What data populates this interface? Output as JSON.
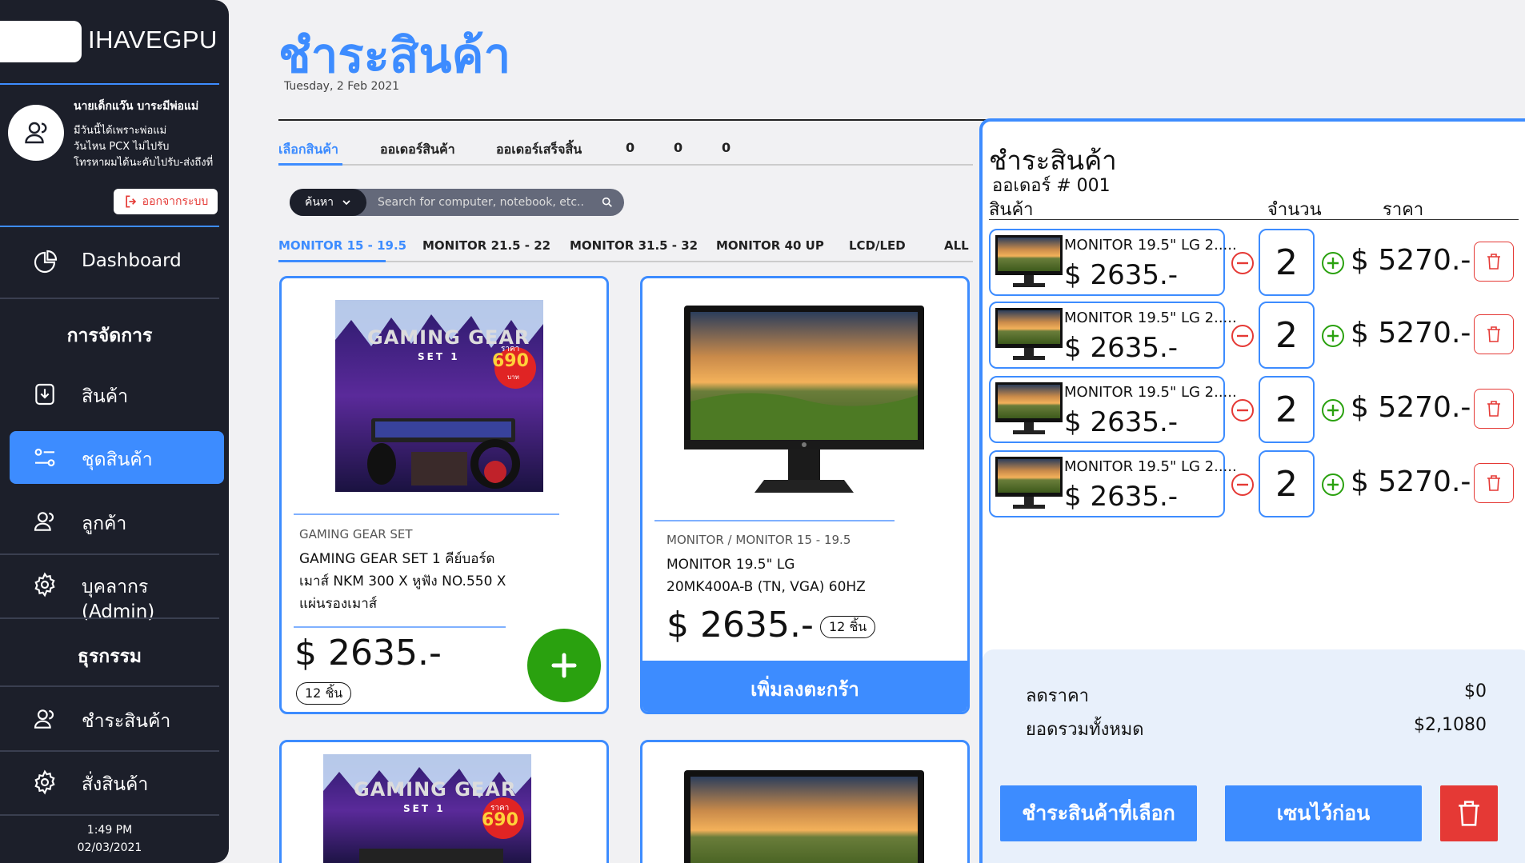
{
  "sidebar": {
    "brand": "IHAVEGPU",
    "profile": {
      "name": "นายเด็กแว๊น    บาระมีพ่อแม่",
      "lines": [
        "มีวันนี้ได้เพราะพ่อแม่",
        "วันไหน PCX ไม่ไปรับ",
        "โทรหาผมได้นะคับไปรับ-ส่งถึงที่"
      ]
    },
    "logout_label": "ออกจากระบบ",
    "nav": [
      {
        "label": "Dashboard",
        "icon": "pie-chart-icon"
      },
      {
        "label": "สินค้า",
        "icon": "download-box-icon"
      },
      {
        "label": "ชุดสินค้า",
        "icon": "settings-sliders-icon"
      },
      {
        "label": "ลูกค้า",
        "icon": "users-icon"
      },
      {
        "label": "บุคลากร (Admin)",
        "icon": "gear-icon"
      },
      {
        "label": "ชำระสินค้า",
        "icon": "users-icon"
      },
      {
        "label": "สั่งสินค้า",
        "icon": "gear-icon"
      }
    ],
    "section_manage": "การจัดการ",
    "section_transaction": "ธุรกรรม",
    "time": "1:49 PM",
    "date": "02/03/2021"
  },
  "main": {
    "title": "ชำระสินค้า",
    "date": "Tuesday, 2 Feb 2021",
    "tabs": [
      {
        "label": "เลือกสินค้า",
        "active": true
      },
      {
        "label": "ออเดอร์สินค้า",
        "active": false
      },
      {
        "label": "ออเดอร์เสร็จสิ้น",
        "active": false
      },
      {
        "label": "0",
        "active": false
      },
      {
        "label": "0",
        "active": false
      },
      {
        "label": "0",
        "active": false
      }
    ],
    "search": {
      "select_label": "ค้นหา",
      "placeholder": "Search for computer, notebook, etc.."
    },
    "categories": [
      "MONITOR 15 - 19.5",
      "MONITOR 21.5 - 22",
      "MONITOR 31.5 - 32",
      "MONITOR 40 UP",
      "LCD/LED",
      "ALL"
    ],
    "products": [
      {
        "category": "GAMING GEAR SET",
        "name_lines": [
          "GAMING GEAR SET 1 คีย์บอร์ด",
          "เมาส์ NKM 300 X หูฟัง NO.550 X",
          "แผ่นรองเมาส์"
        ],
        "price": "$ 2635.-",
        "stock": "12 ชิ้น",
        "promo_title": "GAMING GEAR",
        "promo_set": "SET 1",
        "promo_price_label": "ราคา",
        "promo_price": "690",
        "promo_unit": "บาท"
      },
      {
        "category": "MONITOR / MONITOR 15 - 19.5",
        "name_lines": [
          "MONITOR 19.5\" LG",
          "20MK400A-B (TN, VGA) 60HZ"
        ],
        "price": "$ 2635.-",
        "stock": "12 ชิ้น",
        "button": "เพิ่มลงตะกร้า"
      }
    ]
  },
  "checkout": {
    "title": "ชำระสินค้า",
    "order": "ออเดอร์ # 001",
    "col_product": "สินค้า",
    "col_qty": "จำนวน",
    "col_price": "ราคา",
    "items": [
      {
        "name": "MONITOR 19.5\" LG 2.....",
        "unit_price": "$ 2635.-",
        "qty": "2",
        "total": "$ 5270.-"
      },
      {
        "name": "MONITOR 19.5\" LG 2.....",
        "unit_price": "$ 2635.-",
        "qty": "2",
        "total": "$ 5270.-"
      },
      {
        "name": "MONITOR 19.5\" LG 2.....",
        "unit_price": "$ 2635.-",
        "qty": "2",
        "total": "$ 5270.-"
      },
      {
        "name": "MONITOR 19.5\" LG 2.....",
        "unit_price": "$ 2635.-",
        "qty": "2",
        "total": "$ 5270.-"
      }
    ],
    "discount_label": "ลดราคา",
    "discount_value": "$0",
    "total_label": "ยอดรวมทั้งหมด",
    "total_value": "$2,1080",
    "pay_button": "ชำระสินค้าที่เลือก",
    "hold_button": "เซนไว้ก่อน"
  },
  "colors": {
    "accent": "#3d8cff",
    "sidebar": "#1c1f2a",
    "add_green": "#2aa10f",
    "danger": "#e53935"
  }
}
